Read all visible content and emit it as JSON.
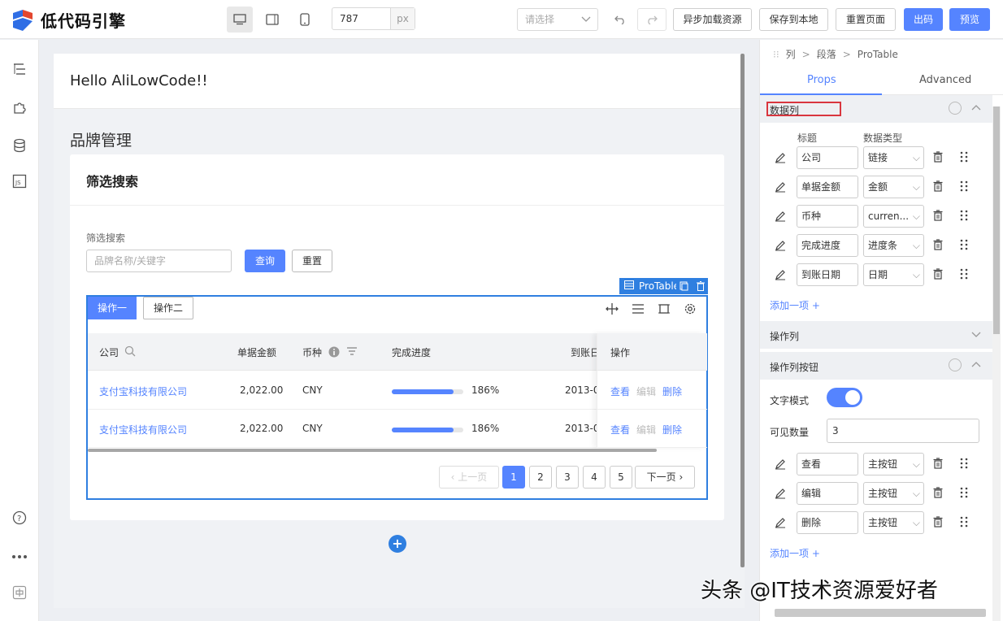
{
  "app": {
    "title": "低代码引擎"
  },
  "toolbar": {
    "width_value": "787",
    "width_unit": "px",
    "select_placeholder": "请选择",
    "buttons": {
      "async_load": "异步加载资源",
      "save_local": "保存到本地",
      "reset_page": "重置页面",
      "export_code": "出码",
      "preview": "预览"
    }
  },
  "canvas": {
    "hello": "Hello AliLowCode!!",
    "brand_title": "品牌管理",
    "card_title": "筛选搜索",
    "filter_label": "筛选搜索",
    "filter_placeholder": "品牌名称/关键字",
    "query_button": "查询",
    "reset_button": "重置",
    "protable_tag": "ProTable",
    "op_tabs": [
      "操作一",
      "操作二"
    ],
    "columns": [
      "公司",
      "单据金额",
      "币种",
      "完成进度",
      "到账日",
      "操作"
    ],
    "rows": [
      {
        "company": "支付宝科技有限公司",
        "amount": "2,022.00",
        "currency": "CNY",
        "progress": 0.86,
        "progress_text": "186%",
        "date": "2013-0",
        "actions": [
          "查看",
          "编辑",
          "删除"
        ]
      },
      {
        "company": "支付宝科技有限公司",
        "amount": "2,022.00",
        "currency": "CNY",
        "progress": 0.86,
        "progress_text": "186%",
        "date": "2013-0",
        "actions": [
          "查看",
          "编辑",
          "删除"
        ]
      }
    ],
    "pagination": {
      "prev": "上一页",
      "pages": [
        "1",
        "2",
        "3",
        "4",
        "5"
      ],
      "current": "1",
      "next": "下一页"
    }
  },
  "panel": {
    "breadcrumb": [
      "列",
      "段落",
      "ProTable"
    ],
    "tabs": [
      "Props",
      "Advanced"
    ],
    "data_columns": {
      "title": "数据列",
      "header_title": "标题",
      "header_type": "数据类型",
      "items": [
        {
          "title": "公司",
          "type": "链接"
        },
        {
          "title": "单据金额",
          "type": "金额"
        },
        {
          "title": "币种",
          "type": "curren..."
        },
        {
          "title": "完成进度",
          "type": "进度条"
        },
        {
          "title": "到账日期",
          "type": "日期"
        }
      ],
      "add": "添加一项 +"
    },
    "action_column": {
      "title": "操作列"
    },
    "action_buttons": {
      "title": "操作列按钮",
      "text_mode_label": "文字模式",
      "text_mode_on": true,
      "visible_count_label": "可见数量",
      "visible_count": "3",
      "items": [
        {
          "title": "查看",
          "type": "主按钮"
        },
        {
          "title": "编辑",
          "type": "主按钮"
        },
        {
          "title": "删除",
          "type": "主按钮"
        }
      ],
      "add": "添加一项 +"
    }
  },
  "watermark": "头条 @IT技术资源爱好者",
  "colors": {
    "primary": "#5584ff",
    "selection": "#2f7fe0",
    "highlight": "#d9363e"
  }
}
